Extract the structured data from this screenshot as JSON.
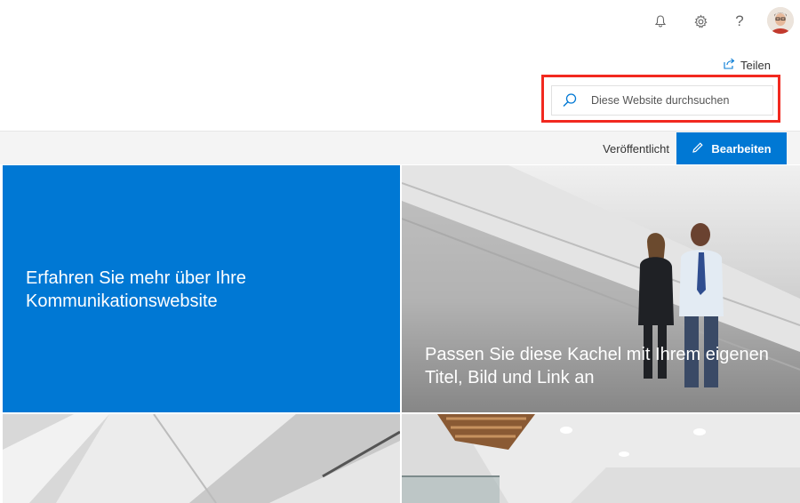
{
  "header": {
    "notifications_icon": "bell-icon",
    "settings_icon": "gear-icon",
    "help_icon": "question-icon",
    "avatar": "user-avatar"
  },
  "share": {
    "label": "Teilen",
    "icon": "share-icon"
  },
  "search": {
    "placeholder": "Diese Website durchsuchen",
    "icon": "search-icon"
  },
  "commandbar": {
    "status": "Veröffentlicht",
    "edit_label": "Bearbeiten",
    "edit_icon": "pencil-icon"
  },
  "tiles": [
    {
      "title": "Erfahren Sie mehr über Ihre Kommunikationswebsite"
    },
    {
      "title": "Passen Sie diese Kachel mit Ihrem eigenen Titel, Bild und Link an"
    },
    {
      "title": ""
    },
    {
      "title": ""
    }
  ],
  "colors": {
    "accent": "#0078d4",
    "highlight": "#f2291f",
    "commandbar_bg": "#f4f4f4"
  }
}
